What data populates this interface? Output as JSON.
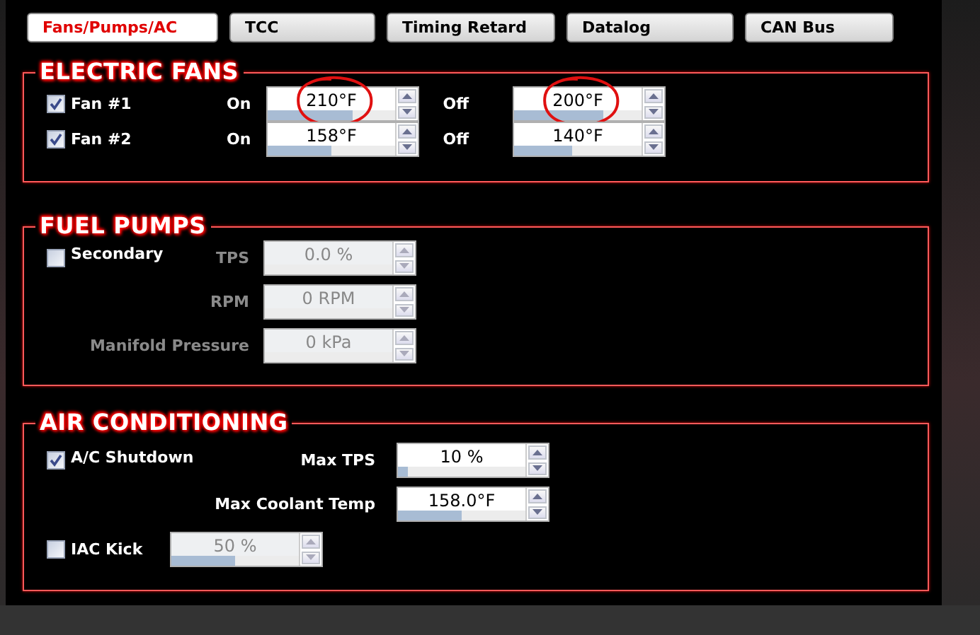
{
  "tabs": [
    {
      "label": "Fans/Pumps/AC",
      "selected": true
    },
    {
      "label": "TCC",
      "selected": false
    },
    {
      "label": "Timing Retard",
      "selected": false
    },
    {
      "label": "Datalog",
      "selected": false
    },
    {
      "label": "CAN Bus",
      "selected": false
    }
  ],
  "electric_fans": {
    "title": "ELECTRIC FANS",
    "fans": [
      {
        "label": "Fan #1",
        "checked": true,
        "on_label": "On",
        "on": {
          "value": "210°F",
          "level": 0.67,
          "circled": true
        },
        "off_label": "Off",
        "off": {
          "value": "200°F",
          "level": 0.7,
          "circled": true
        }
      },
      {
        "label": "Fan #2",
        "checked": true,
        "on_label": "On",
        "on": {
          "value": "158°F",
          "level": 0.5
        },
        "off_label": "Off",
        "off": {
          "value": "140°F",
          "level": 0.45
        }
      }
    ]
  },
  "fuel_pumps": {
    "title": "FUEL PUMPS",
    "secondary": {
      "label": "Secondary",
      "checked": false
    },
    "fields": [
      {
        "label": "TPS",
        "value": "0.0 %",
        "disabled": true
      },
      {
        "label": "RPM",
        "value": "0 RPM",
        "disabled": true
      },
      {
        "label": "Manifold Pressure",
        "value": "0 kPa",
        "disabled": true
      }
    ]
  },
  "air_conditioning": {
    "title": "AIR CONDITIONING",
    "shutdown": {
      "label": "A/C Shutdown",
      "checked": true
    },
    "fields": [
      {
        "label": "Max TPS",
        "value": "10 %",
        "level": 0.08,
        "disabled": false
      },
      {
        "label": "Max Coolant Temp",
        "value": "158.0°F",
        "level": 0.5,
        "disabled": false
      }
    ],
    "iac_kick": {
      "label": "IAC Kick",
      "checked": false,
      "spinner": {
        "value": "50 %",
        "level": 0.5,
        "disabled": true
      }
    }
  }
}
